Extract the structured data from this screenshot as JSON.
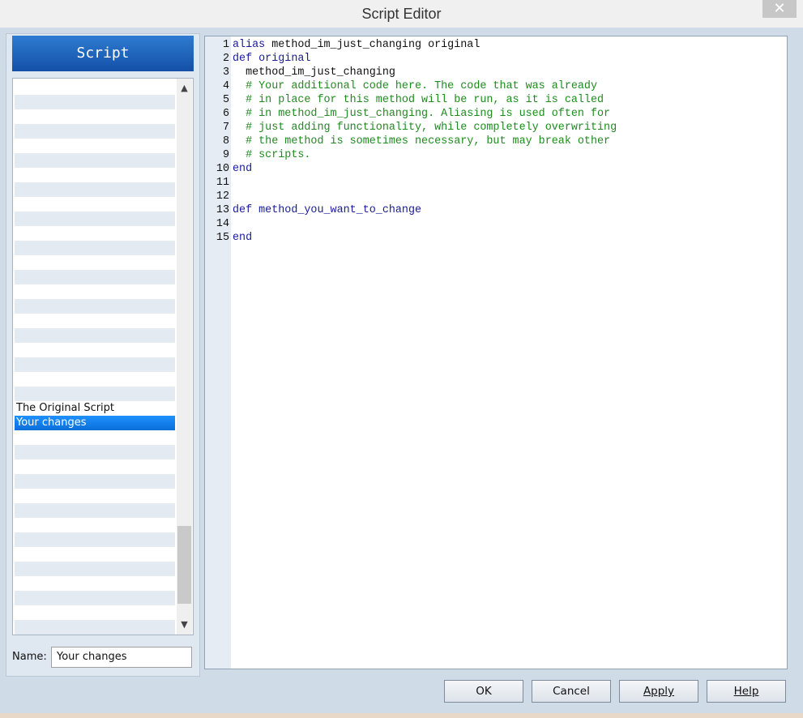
{
  "window": {
    "title": "Script Editor",
    "close_glyph": "✕"
  },
  "sidebar": {
    "header": "Script",
    "list_items": [
      "",
      "",
      "",
      "",
      "",
      "",
      "",
      "",
      "",
      "",
      "",
      "",
      "",
      "",
      "",
      "",
      "",
      "",
      "",
      "",
      "",
      "",
      "The Original Script",
      "Your changes",
      "",
      "",
      "",
      "",
      "",
      "",
      "",
      "",
      "",
      "",
      "",
      "",
      "",
      "",
      ""
    ],
    "selected_index": 23,
    "name_label": "Name:",
    "name_value": "Your changes"
  },
  "editor": {
    "lines": [
      {
        "n": "1",
        "parts": [
          [
            "kw",
            "alias"
          ],
          [
            "plain",
            " method_im_just_changing original"
          ]
        ]
      },
      {
        "n": "2",
        "parts": [
          [
            "kw",
            "def original"
          ]
        ]
      },
      {
        "n": "3",
        "parts": [
          [
            "plain",
            "  method_im_just_changing"
          ]
        ]
      },
      {
        "n": "4",
        "parts": [
          [
            "cm",
            "  # Your additional code here. The code that was already"
          ]
        ]
      },
      {
        "n": "5",
        "parts": [
          [
            "cm",
            "  # in place for this method will be run, as it is called"
          ]
        ]
      },
      {
        "n": "6",
        "parts": [
          [
            "cm",
            "  # in method_im_just_changing. Aliasing is used often for"
          ]
        ]
      },
      {
        "n": "7",
        "parts": [
          [
            "cm",
            "  # just adding functionality, while completely overwriting"
          ]
        ]
      },
      {
        "n": "8",
        "parts": [
          [
            "cm",
            "  # the method is sometimes necessary, but may break other"
          ]
        ]
      },
      {
        "n": "9",
        "parts": [
          [
            "cm",
            "  # scripts."
          ]
        ]
      },
      {
        "n": "10",
        "parts": [
          [
            "kw",
            "end"
          ]
        ]
      },
      {
        "n": "11",
        "parts": []
      },
      {
        "n": "12",
        "parts": []
      },
      {
        "n": "13",
        "parts": [
          [
            "kw",
            "def method_you_want_to_change"
          ]
        ]
      },
      {
        "n": "14",
        "parts": []
      },
      {
        "n": "15",
        "parts": [
          [
            "kw",
            "end"
          ]
        ]
      }
    ]
  },
  "buttons": {
    "ok": "OK",
    "cancel": "Cancel",
    "apply": "Apply",
    "help": "Help"
  }
}
